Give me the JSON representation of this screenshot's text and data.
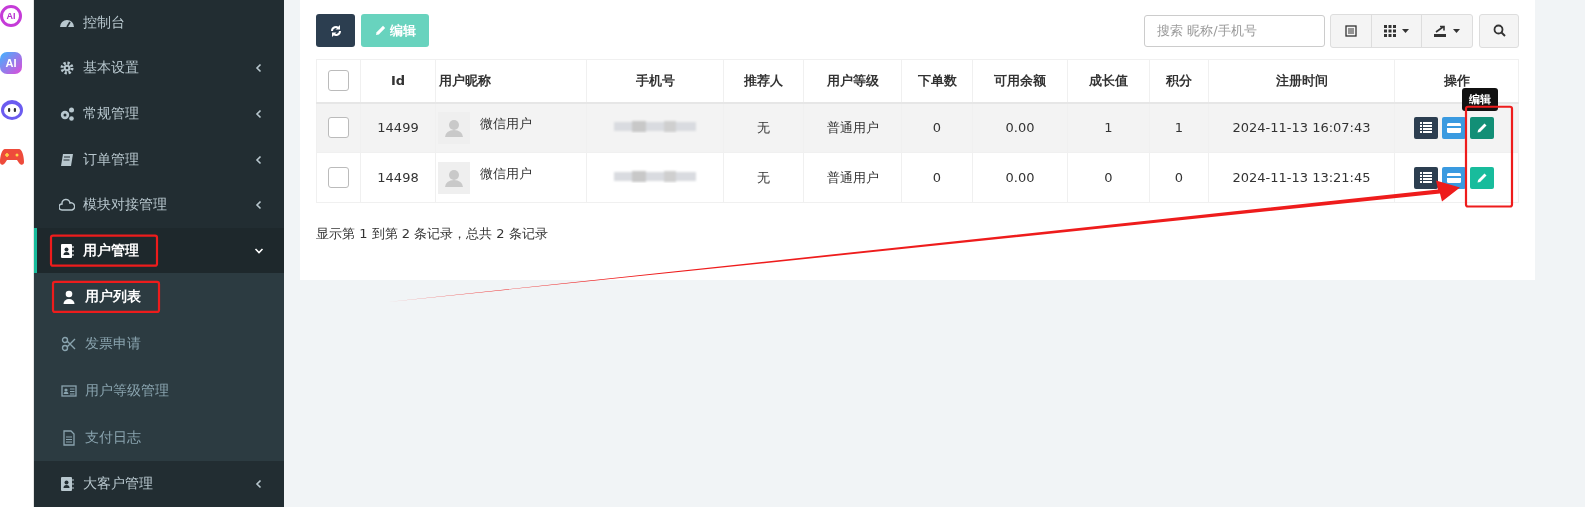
{
  "dock": [
    {
      "kind": "ai-ring",
      "label": "AI"
    },
    {
      "kind": "ai-tile",
      "label": "AI"
    },
    {
      "kind": "robot"
    },
    {
      "kind": "gamepad"
    }
  ],
  "sidebar": {
    "items": [
      {
        "label": "控制台",
        "kind": "link",
        "expanded": false,
        "selected": false,
        "annotated": false
      },
      {
        "label": "基本设置",
        "kind": "menu",
        "expanded": false,
        "selected": false,
        "annotated": false
      },
      {
        "label": "常规管理",
        "kind": "menu",
        "expanded": false,
        "selected": false,
        "annotated": false
      },
      {
        "label": "订单管理",
        "kind": "menu",
        "expanded": false,
        "selected": false,
        "annotated": false
      },
      {
        "label": "模块对接管理",
        "kind": "menu",
        "expanded": false,
        "selected": false,
        "annotated": false
      },
      {
        "label": "用户管理",
        "kind": "menu",
        "expanded": true,
        "selected": true,
        "annotated": true,
        "children": [
          {
            "label": "用户列表",
            "selected": true,
            "annotated": true
          },
          {
            "label": "发票申请",
            "selected": false,
            "annotated": false
          },
          {
            "label": "用户等级管理",
            "selected": false,
            "annotated": false
          },
          {
            "label": "支付日志",
            "selected": false,
            "annotated": false
          }
        ]
      },
      {
        "label": "大客户管理",
        "kind": "menu",
        "expanded": false,
        "selected": false,
        "annotated": false
      }
    ]
  },
  "toolbar": {
    "edit_button": {
      "label": "编辑",
      "disabled": true
    },
    "search": {
      "placeholder": "搜索 昵称/手机号"
    }
  },
  "table": {
    "all_checked": false,
    "columns": [
      "Id",
      "用户昵称",
      "手机号",
      "推荐人",
      "用户等级",
      "下单数",
      "可用余额",
      "成长值",
      "积分",
      "注册时间",
      "操作"
    ],
    "rows": [
      {
        "checked": false,
        "highlighted": true,
        "id": "14499",
        "nickname": "微信用户",
        "referrer": "无",
        "level": "普通用户",
        "orders": "0",
        "balance": "0.00",
        "growth": "1",
        "points": "1",
        "registered": "2024-11-13 16:07:43",
        "edit_tooltip": "编辑"
      },
      {
        "checked": false,
        "highlighted": false,
        "id": "14498",
        "nickname": "微信用户",
        "referrer": "无",
        "level": "普通用户",
        "orders": "0",
        "balance": "0.00",
        "growth": "0",
        "points": "0",
        "registered": "2024-11-13 13:21:45"
      }
    ]
  },
  "pagination_info": "显示第 1 到第 2 条记录，总共 2 条记录",
  "annotations": {
    "edit_column_box": true,
    "arrow": true
  }
}
